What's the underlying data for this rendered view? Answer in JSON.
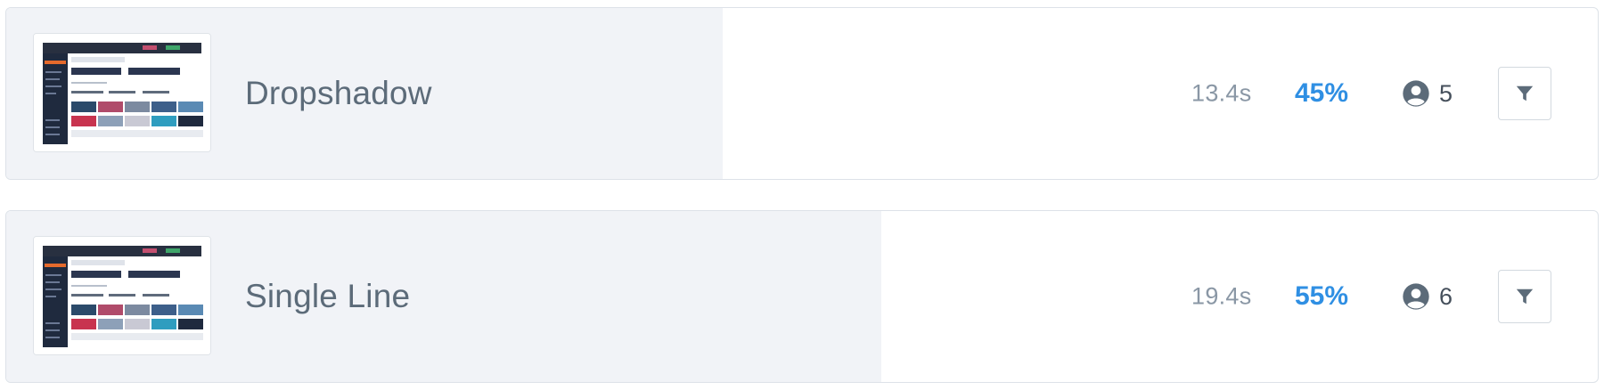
{
  "items": [
    {
      "name": "Dropshadow",
      "duration": "13.4s",
      "percent": "45%",
      "percent_value": 0.45,
      "users": "5"
    },
    {
      "name": "Single Line",
      "duration": "19.4s",
      "percent": "55%",
      "percent_value": 0.55,
      "users": "6"
    }
  ],
  "colors": {
    "percent": "#2f8fe3",
    "fill": "#f1f3f7",
    "title": "#5c6b79"
  },
  "icons": {
    "users": "user-circle-icon",
    "filter": "filter-icon"
  }
}
